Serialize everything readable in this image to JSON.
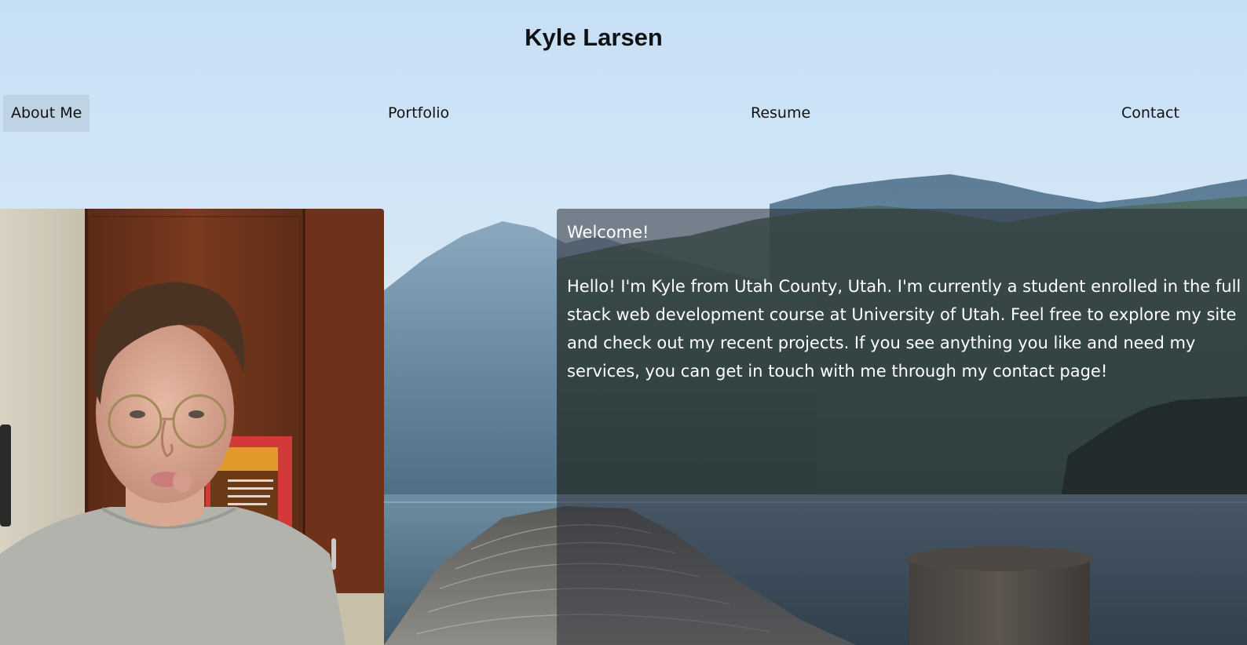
{
  "header": {
    "title": "Kyle Larsen"
  },
  "nav": {
    "items": [
      {
        "label": "About Me",
        "active": true
      },
      {
        "label": "Portfolio",
        "active": false
      },
      {
        "label": "Resume",
        "active": false
      },
      {
        "label": "Contact",
        "active": false
      }
    ]
  },
  "about": {
    "heading": "Welcome!",
    "body": "Hello! I'm Kyle from Utah County, Utah. I'm currently a student enrolled in the full stack web development course at University of Utah. Feel free to explore my site and check out my recent projects. If you see anything you like and need my services, you can get in touch with me through my contact page!"
  },
  "colors": {
    "sky": "#cfe2f3",
    "panel_overlay": "rgba(40,44,52,0.55)",
    "active_nav": "#b9cdde"
  }
}
